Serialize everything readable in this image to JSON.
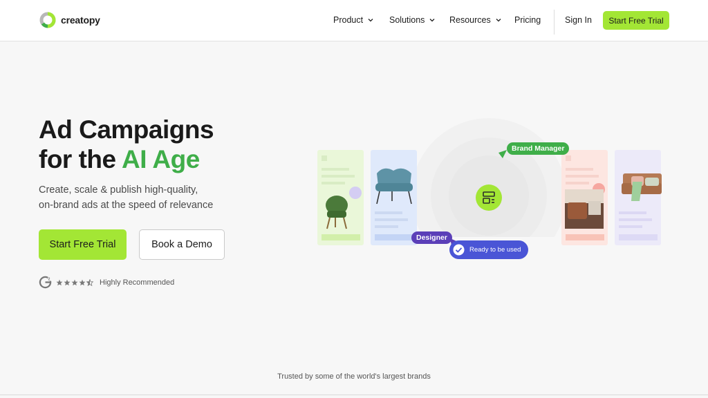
{
  "brand": {
    "name": "creatopy"
  },
  "nav": {
    "items": [
      {
        "label": "Product",
        "dropdown": true
      },
      {
        "label": "Solutions",
        "dropdown": true
      },
      {
        "label": "Resources",
        "dropdown": true
      },
      {
        "label": "Pricing",
        "dropdown": false
      }
    ],
    "sign_in": "Sign In",
    "cta": "Start Free Trial"
  },
  "hero": {
    "title_line1": "Ad Campaigns",
    "title_line2_prefix": "for the ",
    "title_line2_accent": "AI Age",
    "subtitle_line1": "Create, scale & publish high-quality,",
    "subtitle_line2": "on-brand ads at the speed of relevance",
    "primary_button": "Start Free Trial",
    "secondary_button": "Book a Demo",
    "rating": {
      "stars": 4.5,
      "label": "Highly Recommended"
    }
  },
  "illustration": {
    "tags": {
      "brand_manager": "Brand Manager",
      "designer": "Designer",
      "ready": "Ready to be used"
    }
  },
  "footer": {
    "trusted": "Trusted by some of the world's largest brands"
  },
  "colors": {
    "accent": "#a3e635",
    "title_accent": "#3fae49",
    "designer_tag": "#5b3fb8",
    "ready_tag": "#4a55d6",
    "brand_manager_tag": "#3fae49"
  }
}
